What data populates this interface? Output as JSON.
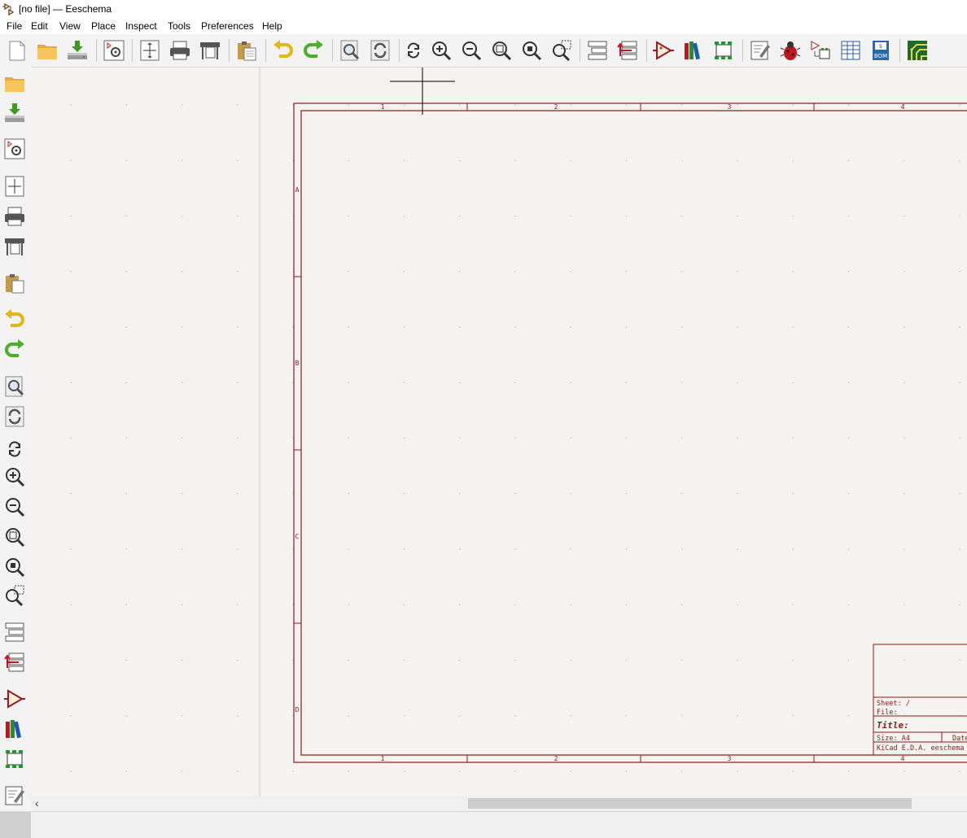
{
  "window": {
    "title": "[no file] — Eeschema"
  },
  "menu": [
    "File",
    "Edit",
    "View",
    "Place",
    "Inspect",
    "Tools",
    "Preferences",
    "Help"
  ],
  "toolbar": {
    "icons": [
      "new-schematic-icon",
      "open-folder-icon",
      "save-icon",
      "schematic-setup-icon",
      "page-settings-icon",
      "print-icon",
      "plot-icon",
      "paste-icon",
      "undo-icon",
      "redo-icon",
      "find-icon",
      "find-replace-icon",
      "refresh-icon",
      "zoom-in-icon",
      "zoom-out-icon",
      "zoom-fit-icon",
      "zoom-objects-icon",
      "zoom-selection-icon",
      "hierarchy-navigator-icon",
      "leave-sheet-icon",
      "symbol-editor-icon",
      "symbol-library-browser-icon",
      "footprint-editor-icon",
      "annotate-icon",
      "erc-icon",
      "assign-footprints-icon",
      "symbol-fields-table-icon",
      "bom-icon",
      "pcbnew-icon"
    ]
  },
  "sheet": {
    "columns": [
      "1",
      "2",
      "3",
      "4"
    ],
    "rows": [
      "A",
      "B",
      "C",
      "D"
    ],
    "title_block": {
      "sheet": "Sheet: /",
      "file": "File:",
      "title": "Title:",
      "size": "Size: A4",
      "date": "Date",
      "footer": "KiCad E.D.A.  eeschema"
    }
  },
  "colors": {
    "border": "#8b1a1a",
    "canvas": "#f4f3ef",
    "grid": "#b8b8b8"
  }
}
